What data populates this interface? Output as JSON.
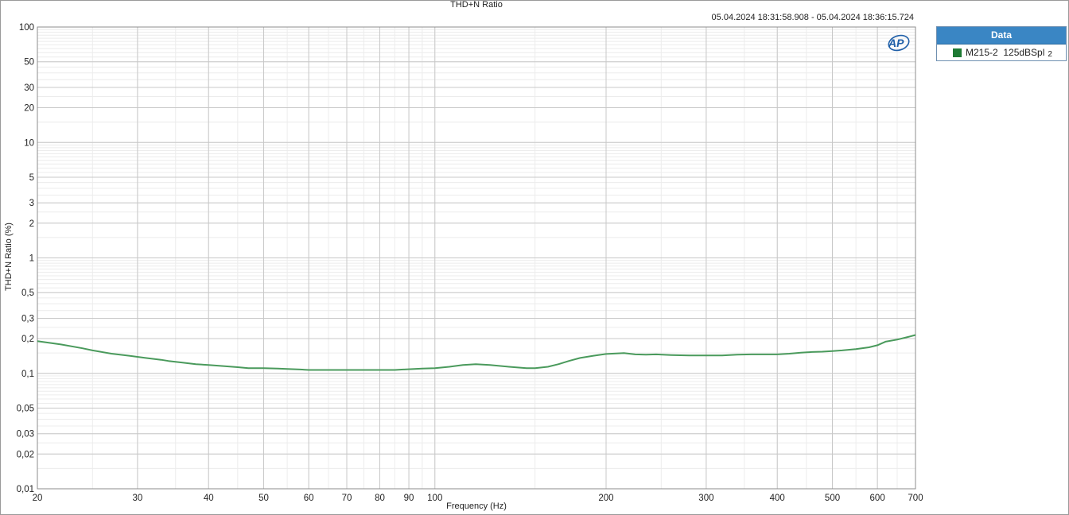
{
  "chart_data": {
    "type": "line",
    "title": "THD+N Ratio",
    "timestamp": "05.04.2024 18:31:58.908 - 05.04.2024 18:36:15.724",
    "xlabel": "Frequency (Hz)",
    "ylabel": "THD+N Ratio (%)",
    "x_scale": "log",
    "y_scale": "log",
    "xlim": [
      20,
      700
    ],
    "ylim": [
      0.01,
      100
    ],
    "grid": true,
    "x_ticks": [
      {
        "v": 20,
        "t": "20"
      },
      {
        "v": 30,
        "t": "30"
      },
      {
        "v": 40,
        "t": "40"
      },
      {
        "v": 50,
        "t": "50"
      },
      {
        "v": 60,
        "t": "60"
      },
      {
        "v": 70,
        "t": "70"
      },
      {
        "v": 80,
        "t": "80"
      },
      {
        "v": 90,
        "t": "90"
      },
      {
        "v": 100,
        "t": "100"
      },
      {
        "v": 200,
        "t": "200"
      },
      {
        "v": 300,
        "t": "300"
      },
      {
        "v": 400,
        "t": "400"
      },
      {
        "v": 500,
        "t": "500"
      },
      {
        "v": 600,
        "t": "600"
      },
      {
        "v": 700,
        "t": "700"
      }
    ],
    "y_ticks": [
      {
        "v": 100,
        "t": "100"
      },
      {
        "v": 50,
        "t": "50"
      },
      {
        "v": 30,
        "t": "30"
      },
      {
        "v": 20,
        "t": "20"
      },
      {
        "v": 10,
        "t": "10"
      },
      {
        "v": 5,
        "t": "5"
      },
      {
        "v": 3,
        "t": "3"
      },
      {
        "v": 2,
        "t": "2"
      },
      {
        "v": 1,
        "t": "1"
      },
      {
        "v": 0.5,
        "t": "0,5"
      },
      {
        "v": 0.3,
        "t": "0,3"
      },
      {
        "v": 0.2,
        "t": "0,2"
      },
      {
        "v": 0.1,
        "t": "0,1"
      },
      {
        "v": 0.05,
        "t": "0,05"
      },
      {
        "v": 0.03,
        "t": "0,03"
      },
      {
        "v": 0.02,
        "t": "0,02"
      },
      {
        "v": 0.01,
        "t": "0,01"
      }
    ],
    "legend_title": "Data",
    "legend_placement": "right",
    "series": [
      {
        "name": "M215-2  125dBSpl",
        "name_suffix": "2",
        "color": "#4a9a5c",
        "swatch_color": "#1e7a34",
        "x": [
          20,
          22,
          24,
          25,
          27,
          29,
          31,
          33,
          34,
          36,
          38,
          40,
          42,
          45,
          47,
          50,
          53,
          55,
          58,
          60,
          65,
          70,
          75,
          80,
          85,
          88,
          92,
          95,
          100,
          106,
          112,
          118,
          125,
          135,
          145,
          150,
          158,
          165,
          172,
          180,
          190,
          200,
          215,
          225,
          235,
          245,
          260,
          280,
          300,
          320,
          340,
          360,
          380,
          400,
          420,
          440,
          460,
          480,
          500,
          520,
          550,
          580,
          600,
          620,
          650,
          680,
          700
        ],
        "y": [
          0.19,
          0.178,
          0.165,
          0.158,
          0.148,
          0.142,
          0.136,
          0.131,
          0.128,
          0.124,
          0.12,
          0.118,
          0.116,
          0.113,
          0.111,
          0.111,
          0.11,
          0.109,
          0.108,
          0.107,
          0.107,
          0.107,
          0.107,
          0.107,
          0.107,
          0.108,
          0.109,
          0.11,
          0.111,
          0.114,
          0.118,
          0.12,
          0.118,
          0.114,
          0.111,
          0.111,
          0.114,
          0.12,
          0.128,
          0.136,
          0.142,
          0.147,
          0.15,
          0.146,
          0.145,
          0.146,
          0.144,
          0.143,
          0.143,
          0.143,
          0.145,
          0.146,
          0.146,
          0.146,
          0.148,
          0.151,
          0.153,
          0.154,
          0.156,
          0.158,
          0.162,
          0.168,
          0.175,
          0.188,
          0.196,
          0.207,
          0.215
        ]
      }
    ]
  },
  "logo": {
    "text": "AP",
    "color": "#1f5fa8"
  }
}
